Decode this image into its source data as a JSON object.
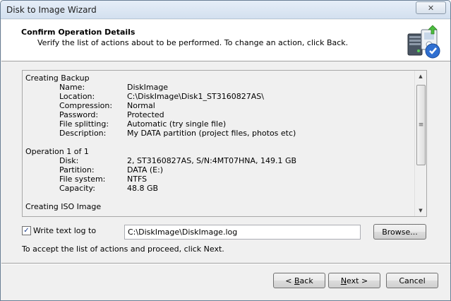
{
  "window": {
    "title": "Disk to Image Wizard",
    "close_glyph": "✕"
  },
  "header": {
    "title": "Confirm Operation Details",
    "subtitle": "Verify the list of actions about to be performed. To change an action, click Back.",
    "icon": "disk-imaging-icon"
  },
  "summary": {
    "sections": [
      {
        "title": "Creating Backup",
        "rows": [
          {
            "key": "Name:",
            "value": "DiskImage"
          },
          {
            "key": "Location:",
            "value": "C:\\DiskImage\\Disk1_ST3160827AS\\"
          },
          {
            "key": "Compression:",
            "value": "Normal"
          },
          {
            "key": "Password:",
            "value": "Protected"
          },
          {
            "key": "File splitting:",
            "value": "Automatic (try single file)"
          },
          {
            "key": "Description:",
            "value": "My DATA partition (project files, photos etc)"
          }
        ]
      },
      {
        "title": "Operation 1 of 1",
        "rows": [
          {
            "key": "Disk:",
            "value": "2, ST3160827AS, S/N:4MT07HNA, 149.1 GB"
          },
          {
            "key": "Partition:",
            "value": "DATA (E:)"
          },
          {
            "key": "File system:",
            "value": "NTFS"
          },
          {
            "key": "Capacity:",
            "value": "48.8 GB"
          }
        ]
      },
      {
        "title": "Creating ISO Image",
        "rows": []
      }
    ],
    "scrollbar": {
      "up_glyph": "▲",
      "down_glyph": "▼",
      "grip_glyph": "≡"
    }
  },
  "log": {
    "checked": true,
    "check_glyph": "✓",
    "label": "Write text log to",
    "path": "C:\\DiskImage\\DiskImage.log",
    "browse_label": "Browse..."
  },
  "hint": "To accept the list of actions and proceed, click Next.",
  "buttons": {
    "back_prefix": "< ",
    "back_mnemonic": "B",
    "back_rest": "ack",
    "next_mnemonic": "N",
    "next_rest": "ext >",
    "cancel": "Cancel"
  }
}
